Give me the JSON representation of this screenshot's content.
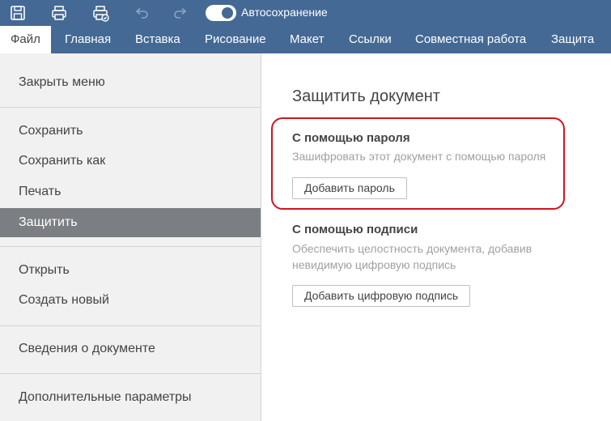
{
  "titlebar": {
    "icons": [
      "save-icon",
      "print-icon",
      "quick-print-icon",
      "undo-icon",
      "redo-icon"
    ],
    "autosave": {
      "label": "Автосохранение",
      "enabled": true
    }
  },
  "menu": {
    "tabs": [
      {
        "label": "Файл",
        "active": true
      },
      {
        "label": "Главная"
      },
      {
        "label": "Вставка"
      },
      {
        "label": "Рисование"
      },
      {
        "label": "Макет"
      },
      {
        "label": "Ссылки"
      },
      {
        "label": "Совместная работа"
      },
      {
        "label": "Защита"
      }
    ]
  },
  "sidebar": {
    "items": [
      {
        "label": "Закрыть меню"
      },
      {
        "label": "Сохранить"
      },
      {
        "label": "Сохранить как"
      },
      {
        "label": "Печать"
      },
      {
        "label": "Защитить",
        "active": true
      },
      {
        "label": "Открыть"
      },
      {
        "label": "Создать новый"
      },
      {
        "label": "Сведения о документе"
      },
      {
        "label": "Дополнительные параметры"
      }
    ]
  },
  "main": {
    "title": "Защитить документ",
    "password": {
      "title": "С помощью пароля",
      "description": "Зашифровать этот документ с помощью пароля",
      "button": "Добавить пароль"
    },
    "signature": {
      "title": "С помощью подписи",
      "description_line1": "Обеспечить целостность документа, добавив",
      "description_line2": "невидимую цифровую подпись",
      "button": "Добавить цифровую подпись"
    }
  },
  "colors": {
    "header": "#446995",
    "sidebar_bg": "#f1f1f1",
    "sidebar_active": "#7b7f84",
    "highlight": "#d0141f"
  }
}
